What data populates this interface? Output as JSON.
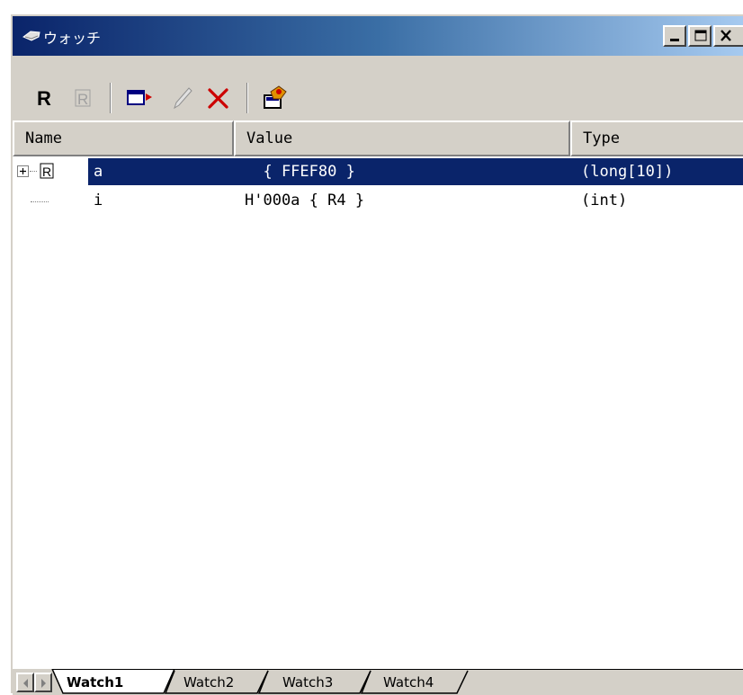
{
  "window": {
    "title": "ウォッチ"
  },
  "toolbar": {
    "buttons": [
      "radix-r-icon",
      "radix-r-disabled-icon",
      "add-watch-icon",
      "edit-icon",
      "delete-icon",
      "settings-icon"
    ]
  },
  "columns": [
    "Name",
    "Value",
    "Type"
  ],
  "rows": [
    {
      "name": "a",
      "value": "  { FFEF80 }",
      "type": "(long[10])",
      "selected": true
    },
    {
      "name": "i",
      "value": "H'000a { R4 }",
      "type": "(int)",
      "selected": false
    }
  ],
  "tabs": [
    "Watch1",
    "Watch2",
    "Watch3",
    "Watch4"
  ],
  "active_tab": "Watch1",
  "colors": {
    "selection": "#0a246a",
    "titlebar_start": "#0a246a",
    "face": "#d4d0c8",
    "delete": "#cc0000"
  }
}
